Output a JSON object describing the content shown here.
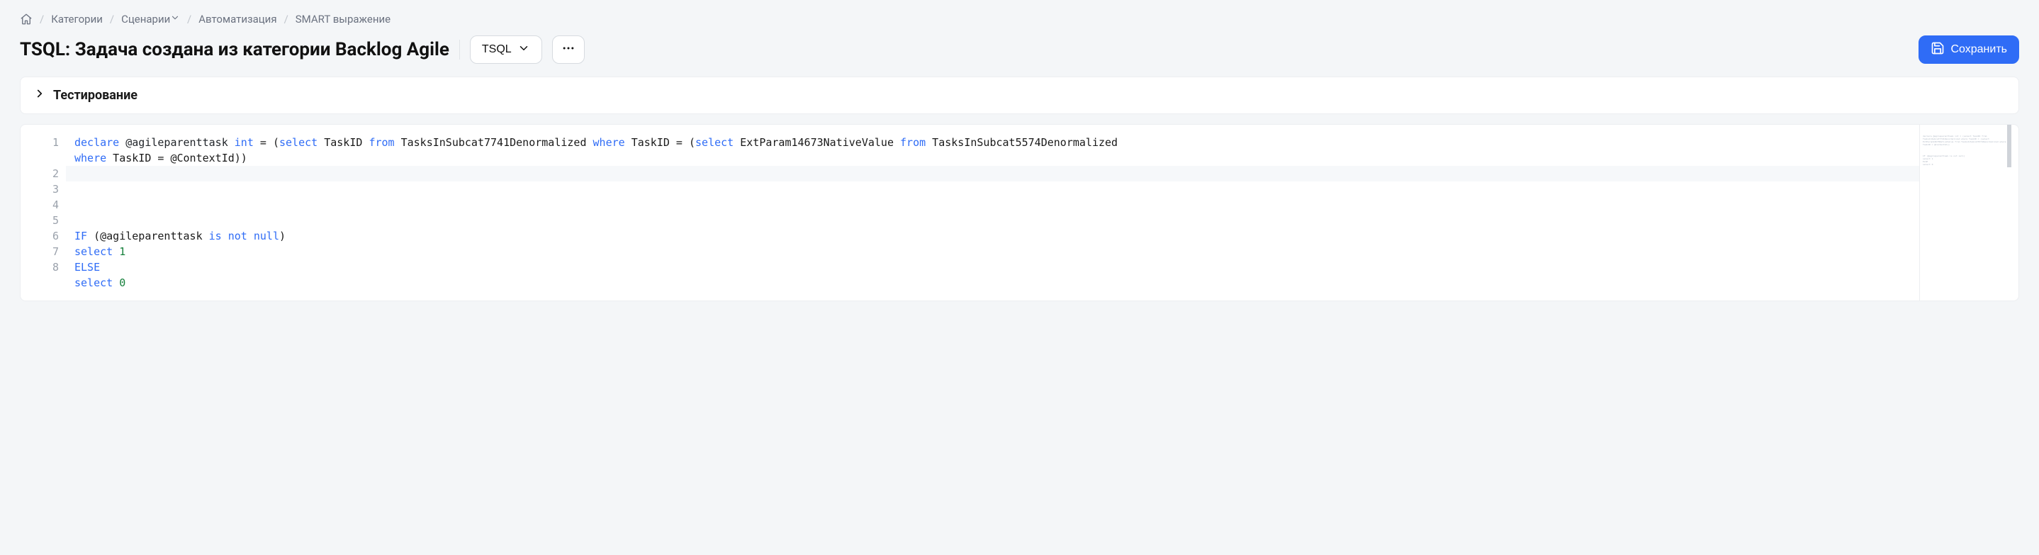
{
  "breadcrumb": {
    "items": [
      {
        "label": "Категории"
      },
      {
        "label": "Сценарии",
        "has_dropdown": true
      },
      {
        "label": "Автоматизация"
      },
      {
        "label": "SMART выражение"
      }
    ]
  },
  "titlebar": {
    "title": "TSQL: Задача создана из категории Backlog Agile",
    "lang_select": "TSQL",
    "save_label": "Сохранить"
  },
  "testing_panel": {
    "label": "Тестирование"
  },
  "editor": {
    "line_numbers": [
      "1",
      "2",
      "3",
      "4",
      "5",
      "6",
      "7",
      "8"
    ],
    "tokens": [
      [
        {
          "t": "declare",
          "c": "kw"
        },
        {
          "t": " "
        },
        {
          "t": "@agileparenttask",
          "c": "id"
        },
        {
          "t": " "
        },
        {
          "t": "int",
          "c": "kw"
        },
        {
          "t": " = ("
        },
        {
          "t": "select",
          "c": "kw"
        },
        {
          "t": " TaskID "
        },
        {
          "t": "from",
          "c": "kw"
        },
        {
          "t": " TasksInSubcat7741Denormalized "
        },
        {
          "t": "where",
          "c": "kw"
        },
        {
          "t": " TaskID = ("
        },
        {
          "t": "select",
          "c": "kw"
        },
        {
          "t": " ExtParam14673NativeValue "
        },
        {
          "t": "from",
          "c": "kw"
        },
        {
          "t": " TasksInSubcat5574Denormalized "
        },
        {
          "t": "where",
          "c": "kw"
        },
        {
          "t": " TaskID = @ContextId))"
        }
      ],
      [],
      [],
      [],
      [
        {
          "t": "IF",
          "c": "kw"
        },
        {
          "t": " (@agileparenttask "
        },
        {
          "t": "is",
          "c": "kw"
        },
        {
          "t": " "
        },
        {
          "t": "not",
          "c": "kw"
        },
        {
          "t": " "
        },
        {
          "t": "null",
          "c": "kw"
        },
        {
          "t": ")"
        }
      ],
      [
        {
          "t": "select",
          "c": "kw"
        },
        {
          "t": " "
        },
        {
          "t": "1",
          "c": "num"
        }
      ],
      [
        {
          "t": "ELSE",
          "c": "kw"
        }
      ],
      [
        {
          "t": "select",
          "c": "kw"
        },
        {
          "t": " "
        },
        {
          "t": "0",
          "c": "num"
        }
      ]
    ],
    "wrapped_first_line_break_at": 16,
    "cursor_logical_line": 2
  }
}
